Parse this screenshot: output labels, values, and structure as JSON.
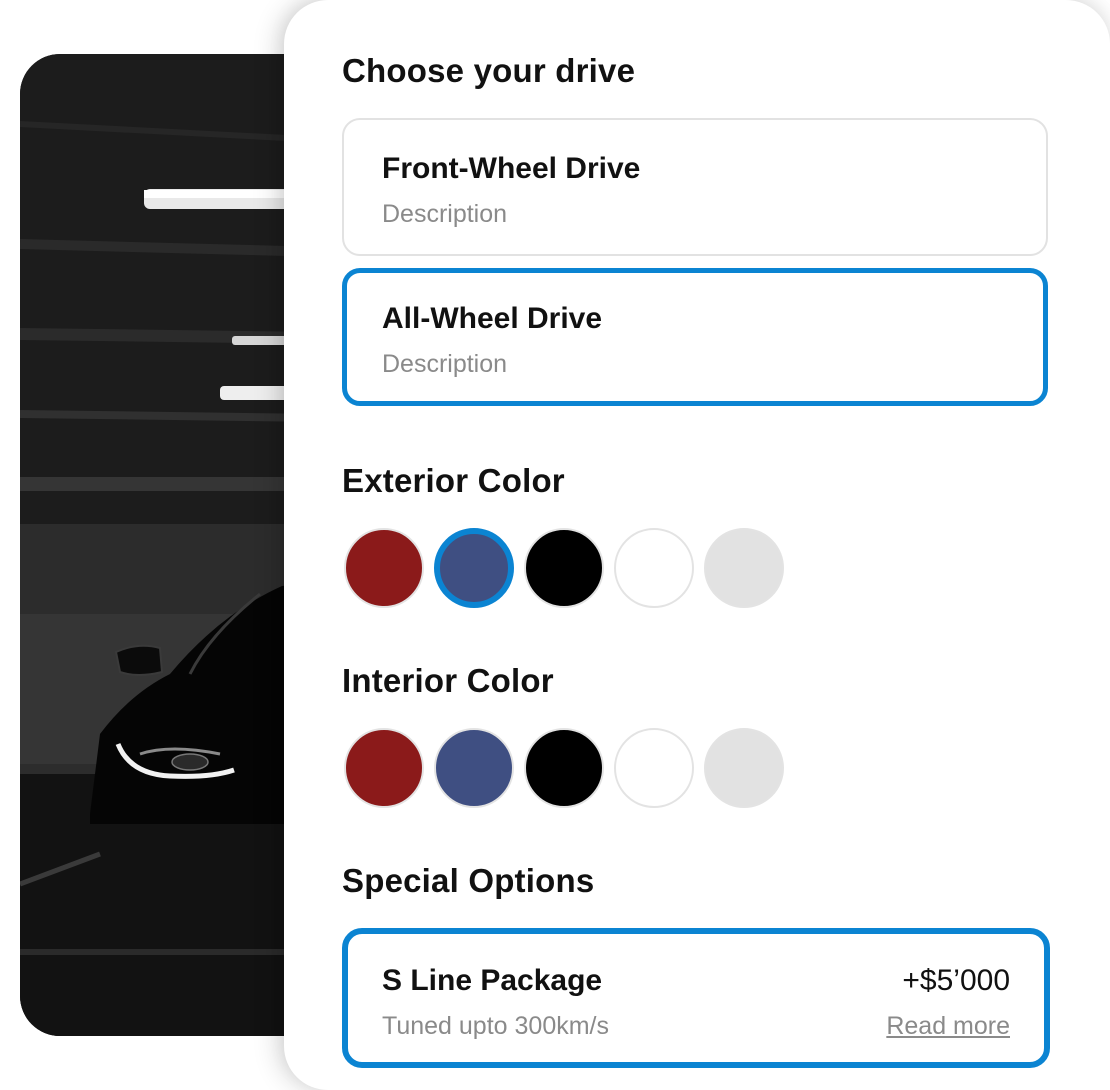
{
  "colors": {
    "accent": "#0b84d2",
    "red": "#8b1a1a",
    "blue": "#3f4f82",
    "black": "#000000",
    "white": "#ffffff",
    "light_gray": "#e2e2e2"
  },
  "drive": {
    "title": "Choose your drive",
    "options": [
      {
        "name": "Front-Wheel Drive",
        "description": "Description",
        "selected": false
      },
      {
        "name": "All-Wheel Drive",
        "description": "Description",
        "selected": true
      }
    ]
  },
  "exterior": {
    "title": "Exterior Color",
    "swatches": [
      {
        "color": "red",
        "selected": false
      },
      {
        "color": "blue",
        "selected": true
      },
      {
        "color": "black",
        "selected": false
      },
      {
        "color": "white",
        "selected": false
      },
      {
        "color": "light-gray",
        "selected": false
      }
    ]
  },
  "interior": {
    "title": "Interior Color",
    "swatches": [
      {
        "color": "red",
        "selected": false
      },
      {
        "color": "blue",
        "selected": false
      },
      {
        "color": "black",
        "selected": false
      },
      {
        "color": "white",
        "selected": false
      },
      {
        "color": "light-gray",
        "selected": false
      }
    ]
  },
  "special": {
    "title": "Special Options",
    "option": {
      "name": "S Line Package",
      "description": "Tuned upto 300km/s",
      "price": "+$5’000",
      "link": "Read more",
      "selected": true
    }
  }
}
